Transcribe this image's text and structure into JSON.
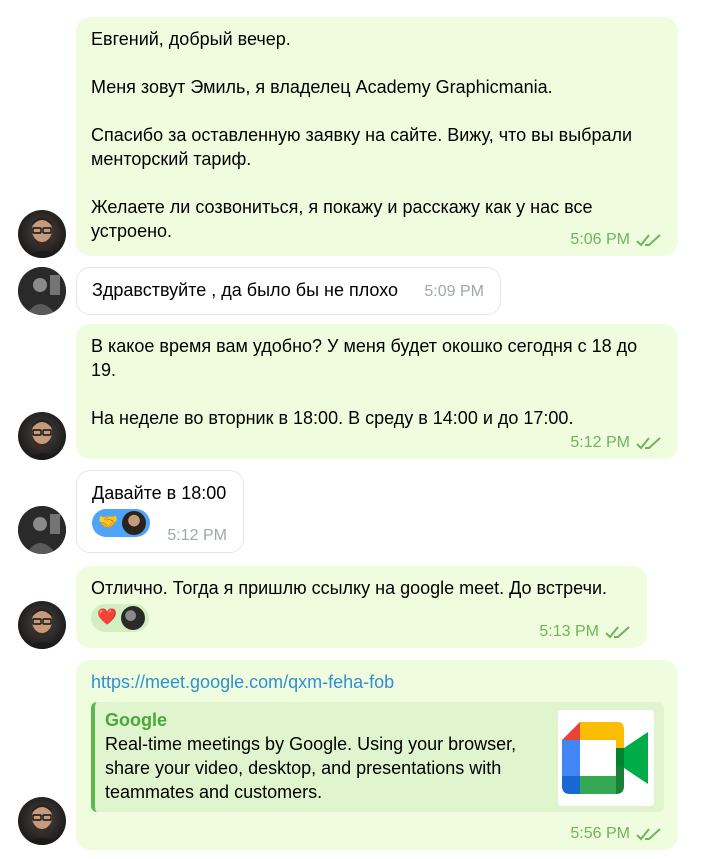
{
  "messages": [
    {
      "sender": "me",
      "text": "Евгений, добрый вечер.\n\nМеня зовут Эмиль, я владелец Academy Graphicmania.\n\nСпасибо за оставленную заявку на сайте. Вижу, что вы выбрали менторский тариф.\n\nЖелаете ли созвониться, я покажу и расскажу как у нас все устроено.",
      "time": "5:06 PM"
    },
    {
      "sender": "client",
      "text": "Здравствуйте , да было бы не плохо",
      "time": "5:09 PM"
    },
    {
      "sender": "me",
      "text": "В какое время вам удобно? У меня будет окошко сегодня с 18 до 19.\n\nНа неделе во вторник в 18:00. В среду в 14:00 и до 17:00.",
      "time": "5:12 PM"
    },
    {
      "sender": "client",
      "text": "Давайте в 18:00",
      "time": "5:12 PM",
      "reaction": {
        "emoji": "🤝",
        "icon": "handshake-icon",
        "color": "#4ea4f6"
      }
    },
    {
      "sender": "me",
      "text": "Отлично. Тогда я пришлю ссылку на google meet. До встречи.",
      "time": "5:13 PM",
      "reaction": {
        "emoji": "❤️",
        "icon": "heart-icon",
        "color": "#d3efc2"
      }
    },
    {
      "sender": "me",
      "link": "https://meet.google.com/qxm-feha-fob",
      "preview": {
        "site": "Google",
        "description": "Real-time meetings by Google. Using your browser, share your video, desktop, and presentations with teammates and customers.",
        "icon": "google-meet-logo"
      },
      "time": "5:56 PM"
    }
  ],
  "colors": {
    "outgoing_bubble": "#effdde",
    "incoming_bubble": "#ffffff",
    "outgoing_time": "#6fb45a",
    "incoming_time": "#a0a7ae",
    "link": "#2f8fd5"
  }
}
